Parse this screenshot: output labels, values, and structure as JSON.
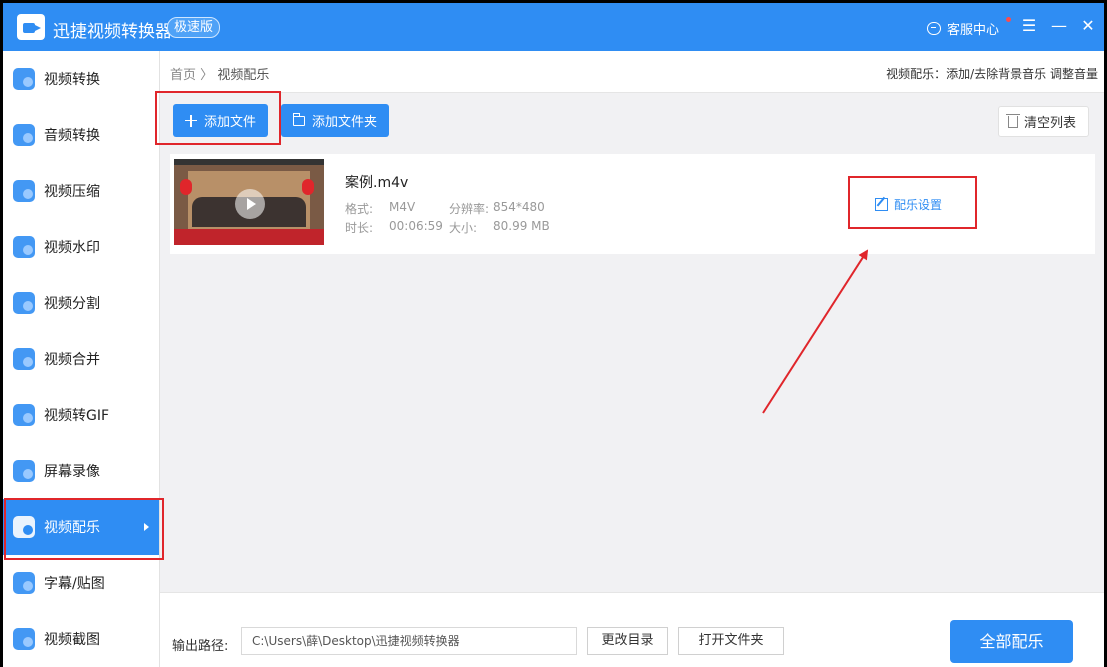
{
  "titlebar": {
    "app_name": "迅捷视频转换器",
    "badge": "极速版",
    "service_label": "客服中心",
    "menu_glyph": "☰",
    "minimize_glyph": "—",
    "close_glyph": "✕"
  },
  "sidebar": {
    "items": [
      {
        "label": "视频转换",
        "icon": "video-convert-icon"
      },
      {
        "label": "音频转换",
        "icon": "audio-convert-icon"
      },
      {
        "label": "视频压缩",
        "icon": "video-compress-icon"
      },
      {
        "label": "视频水印",
        "icon": "video-watermark-icon"
      },
      {
        "label": "视频分割",
        "icon": "video-split-icon"
      },
      {
        "label": "视频合并",
        "icon": "video-merge-icon"
      },
      {
        "label": "视频转GIF",
        "icon": "gif-icon"
      },
      {
        "label": "屏幕录像",
        "icon": "screen-record-icon"
      },
      {
        "label": "视频配乐",
        "icon": "video-music-icon"
      },
      {
        "label": "字幕/贴图",
        "icon": "subtitle-sticker-icon"
      },
      {
        "label": "视频截图",
        "icon": "video-screenshot-icon"
      }
    ],
    "active_index": 8
  },
  "breadcrumb": {
    "home": "首页",
    "separator": "〉",
    "current": "视频配乐",
    "hint": "视频配乐：添加/去除背景音乐 调整音量"
  },
  "toolbar": {
    "add_file": "添加文件",
    "add_folder": "添加文件夹",
    "clear_list": "清空列表"
  },
  "file": {
    "name": "案例.m4v",
    "format_label": "格式:",
    "format": "M4V",
    "resolution_label": "分辨率:",
    "resolution": "854*480",
    "duration_label": "时长:",
    "duration": "00:06:59",
    "size_label": "大小:",
    "size": "80.99 MB",
    "music_settings": "配乐设置"
  },
  "bottom": {
    "output_label": "输出路径:",
    "output_path": "C:\\Users\\薛\\Desktop\\迅捷视频转换器",
    "change_dir": "更改目录",
    "open_folder": "打开文件夹",
    "apply_all": "全部配乐"
  },
  "colors": {
    "accent": "#2f8df3",
    "annotation": "#e0262b"
  }
}
